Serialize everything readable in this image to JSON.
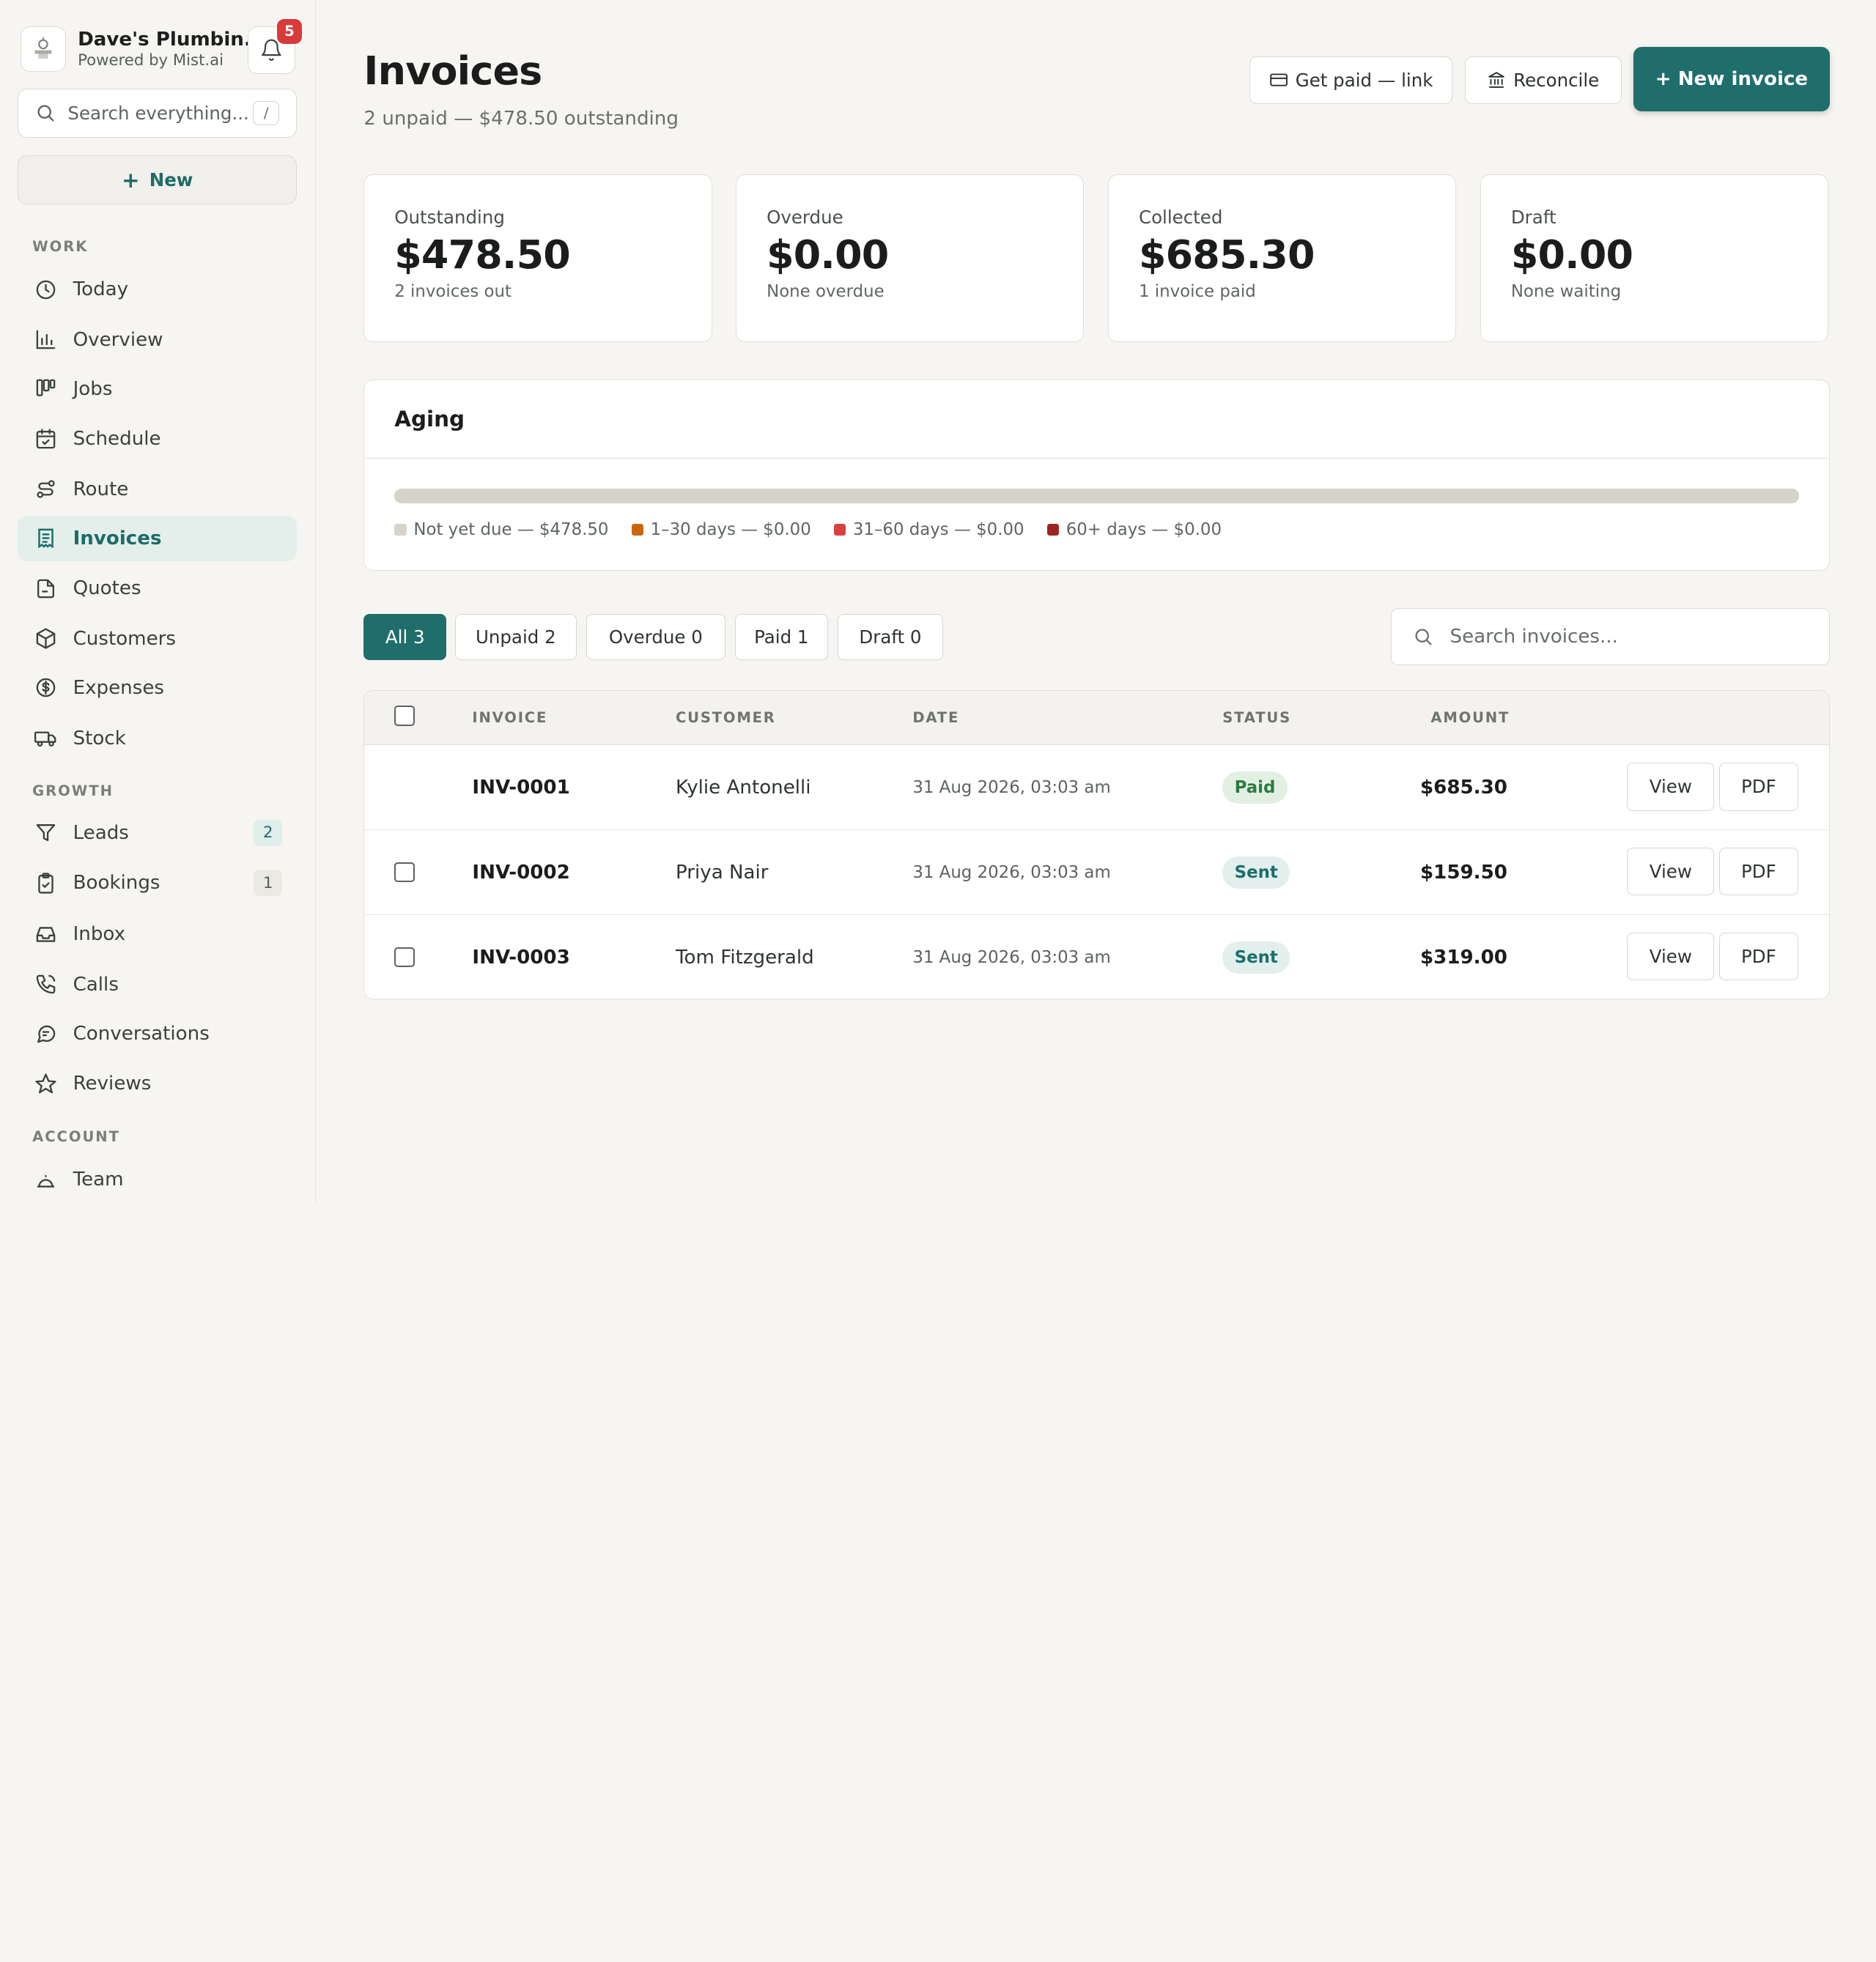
{
  "brand": {
    "name": "Dave's Plumbin...",
    "subtitle": "Powered by Mist.ai",
    "notifications": "5"
  },
  "sidebar": {
    "search_placeholder": "Search everything...",
    "search_shortcut": "/",
    "new_label": "New",
    "sections": {
      "work": "WORK",
      "growth": "GROWTH",
      "account": "ACCOUNT"
    },
    "work_items": [
      {
        "label": "Today",
        "icon": "clock-icon"
      },
      {
        "label": "Overview",
        "icon": "bar-chart-icon"
      },
      {
        "label": "Jobs",
        "icon": "kanban-icon"
      },
      {
        "label": "Schedule",
        "icon": "calendar-check-icon"
      },
      {
        "label": "Route",
        "icon": "route-icon"
      },
      {
        "label": "Invoices",
        "icon": "receipt-icon",
        "active": true
      },
      {
        "label": "Quotes",
        "icon": "file-icon"
      },
      {
        "label": "Customers",
        "icon": "box-icon"
      },
      {
        "label": "Expenses",
        "icon": "dollar-circle-icon"
      },
      {
        "label": "Stock",
        "icon": "truck-icon"
      }
    ],
    "growth_items": [
      {
        "label": "Leads",
        "icon": "funnel-icon",
        "count": "2"
      },
      {
        "label": "Bookings",
        "icon": "clipboard-check-icon",
        "count": "1"
      },
      {
        "label": "Inbox",
        "icon": "inbox-icon"
      },
      {
        "label": "Calls",
        "icon": "phone-icon"
      },
      {
        "label": "Conversations",
        "icon": "chat-icon"
      },
      {
        "label": "Reviews",
        "icon": "star-icon"
      }
    ],
    "account_items": [
      {
        "label": "Team",
        "icon": "team-icon"
      }
    ]
  },
  "header": {
    "title": "Invoices",
    "subtitle": "2 unpaid — $478.50 outstanding",
    "get_paid_label": "Get paid — link",
    "reconcile_label": "Reconcile",
    "new_invoice_label": "+ New invoice"
  },
  "stats": [
    {
      "label": "Outstanding",
      "value": "$478.50",
      "note": "2 invoices out"
    },
    {
      "label": "Overdue",
      "value": "$0.00",
      "note": "None overdue"
    },
    {
      "label": "Collected",
      "value": "$685.30",
      "note": "1 invoice paid"
    },
    {
      "label": "Draft",
      "value": "$0.00",
      "note": "None waiting"
    }
  ],
  "aging": {
    "title": "Aging",
    "buckets": [
      {
        "label": "Not yet due — $478.50",
        "amount": 478.5,
        "color": "#d6d3ca"
      },
      {
        "label": "1–30 days — $0.00",
        "amount": 0,
        "color": "#c8670f"
      },
      {
        "label": "31–60 days — $0.00",
        "amount": 0,
        "color": "#d94141"
      },
      {
        "label": "60+ days — $0.00",
        "amount": 0,
        "color": "#9e2424"
      }
    ]
  },
  "filters": [
    {
      "label": "All 3",
      "active": true
    },
    {
      "label": "Unpaid 2"
    },
    {
      "label": "Overdue 0"
    },
    {
      "label": "Paid 1"
    },
    {
      "label": "Draft 0"
    }
  ],
  "invoice_search_placeholder": "Search invoices...",
  "table": {
    "columns": [
      "INVOICE",
      "CUSTOMER",
      "DATE",
      "STATUS",
      "AMOUNT"
    ],
    "rows": [
      {
        "id": "INV-0001",
        "customer": "Kylie Antonelli",
        "date": "31 Aug 2026, 03:03 am",
        "status": "Paid",
        "amount": "$685.30",
        "checkbox": false
      },
      {
        "id": "INV-0002",
        "customer": "Priya Nair",
        "date": "31 Aug 2026, 03:03 am",
        "status": "Sent",
        "amount": "$159.50",
        "checkbox": true
      },
      {
        "id": "INV-0003",
        "customer": "Tom Fitzgerald",
        "date": "31 Aug 2026, 03:03 am",
        "status": "Sent",
        "amount": "$319.00",
        "checkbox": true
      }
    ],
    "view_label": "View",
    "pdf_label": "PDF"
  },
  "colors": {
    "accent": "#1f6e6b",
    "danger_badge": "#d93a3a"
  }
}
